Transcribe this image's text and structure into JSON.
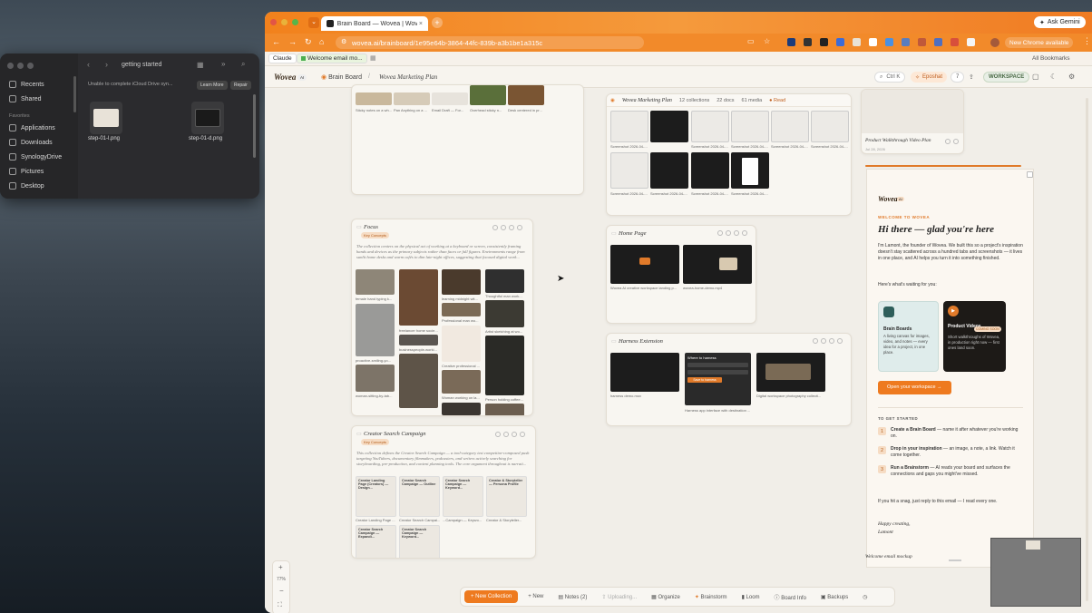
{
  "finder": {
    "folder": "getting started",
    "notice": "Unable to complete iCloud Drive syn...",
    "learn_more": "Learn More",
    "repair": "Repair",
    "sidebar": [
      "Recents",
      "Shared"
    ],
    "favorites_label": "Favorites",
    "favorites": [
      "Applications",
      "Downloads",
      "SynologyDrive",
      "Pictures",
      "Desktop"
    ],
    "files": [
      "step-01-l.png",
      "step-01-d.png"
    ]
  },
  "browser": {
    "tab_title": "Brain Board — Wovea | Wovea",
    "url": "wovea.ai/brainboard/1e95e64b-3864-44fc-839b-a3b1be1a315c",
    "ask_gemini": "Ask Gemini",
    "update": "New Chrome available",
    "all_bookmarks": "All Bookmarks",
    "bookmarks": [
      "Claude",
      "Welcome email mo..."
    ]
  },
  "app": {
    "logo": "Wovea",
    "badge": "AI",
    "crumb1": "Brain Board",
    "crumb2": "Wovea Marketing Plan",
    "search": "Ctrl K",
    "spotlight": "Eposhat",
    "count": "7",
    "workspace": "WORKSPACE"
  },
  "boards": {
    "top_left_caps": [
      "Sticky notes on a wh...",
      "Pan Anything on a ...",
      "Email Draft — For...",
      "Overhead sticky n...",
      "Desk centered in pr..."
    ],
    "focus": {
      "title": "Focus",
      "tag": "Key Concepts",
      "desc": "The collection centers on the physical act of working at a keyboard or screen, consistently framing hands and devices as the primary subjects rather than faces or full figures. Environments range from sunlit home desks and warm cafés to dim late-night offices, suggesting that focused digital work...",
      "caps": [
        "female hand typing k...",
        "learning midnight wit...",
        "Thoughtful man work...",
        "freelancer home socie...",
        "Professional man wo...",
        "Artist sketching at wo...",
        "proactive-smiling-yo...",
        "businesspeople-worki...",
        "Creative professional ...",
        "woman-sitting-by-tab...",
        "Woman working on la...",
        "Person holding coffee..."
      ]
    },
    "creator": {
      "title": "Creator Search Campaign",
      "tag": "Key Concepts",
      "desc": "This collection defines the Creator Search Campaign — a tool-category test competitor-composed push targeting YouTubers, documentary filmmakers, podcasters, and writers actively searching for storyboarding, pre-production, and content planning tools. The core argument throughout is narrati...",
      "cards": [
        "Creator Landing Page (Creators) — Design...",
        "Creator Search Campaign — Outline",
        "Creator Search Campaign — Keyword...",
        "Creator & Storyteller — Persona Profile",
        "Creator Search Campaign — Expandi...",
        "Creator Search Campaign — Keyword..."
      ],
      "caps": [
        "Creator Landing Page ...",
        "Creator Search Campai...",
        "...Campaign — Keywo...",
        "Creator & Storyteller..."
      ]
    },
    "marketing": {
      "title": "Wovea Marketing Plan",
      "collections": "12 collections",
      "docs": "22 docs",
      "media": "61 media",
      "read": "Read",
      "caps": [
        "Screenshot 2026-04-...",
        "Screenshot 2026-04-...",
        "Screenshot 2026-04-...",
        "Screenshot 2026-04-...",
        "Screenshot 2026-04-...",
        "Screenshot 2026-04-...",
        "Screenshot 2026-04-...",
        "Screenshot 2026-04-...",
        "Screenshot 2026-04-..."
      ]
    },
    "homepage": {
      "title": "Home Page",
      "caps": [
        "Wovea AI creative workspace landing p...",
        "wovea-home-demo.mp4"
      ]
    },
    "harness": {
      "title": "Harness Extension",
      "caps": [
        "harness demo.mov",
        "Harness app interface with destination ...",
        "Digital workspace photography collecti..."
      ],
      "popup_title": "Where to harness",
      "popup_btn": "Save to harness"
    },
    "video_plan": {
      "title": "Product Walkthrough Video Plan",
      "date": "Jul 28, 2026"
    }
  },
  "email": {
    "logo": "Wovea",
    "badge": "AI",
    "eyebrow": "WELCOME TO WOVEA",
    "headline": "Hi there — glad you're here",
    "p1": "I'm Lamont, the founder of Wovea. We built this so a project's inspiration doesn't stay scattered across a hundred tabs and screenshots — it lives in one place, and AI helps you turn it into something finished.",
    "p2": "Here's what's waiting for you:",
    "tile1_title": "Brain Boards",
    "tile1_text": "A living canvas for images, video, and notes — every idea for a project, in one place.",
    "tile2_title": "Product Videos",
    "tile2_badge": "COMING SOON",
    "tile2_text": "Short walkthroughs of Wovea, in production right now — first ones land soon.",
    "cta": "Open your workspace →",
    "started": "TO GET STARTED",
    "steps": [
      {
        "n": "1",
        "b": "Create a Brain Board",
        "t": " — name it after whatever you're working on."
      },
      {
        "n": "2",
        "b": "Drop in your inspiration",
        "t": " — an image, a note, a link. Watch it come together."
      },
      {
        "n": "3",
        "b": "Run a Brainstorm",
        "t": " — AI reads your board and surfaces the connections and gaps you might've missed."
      }
    ],
    "p3": "If you hit a snag, just reply to this email — I read every one.",
    "sign1": "Happy creating,",
    "sign2": "Lamont",
    "caption": "Welcome email mockup"
  },
  "zoom": "77%",
  "toolbar": [
    "+ New Collection",
    "+ New",
    "Notes (2)",
    "Uploading...",
    "Organize",
    "Brainstorm",
    "Loom",
    "Board Info",
    "Backups"
  ]
}
